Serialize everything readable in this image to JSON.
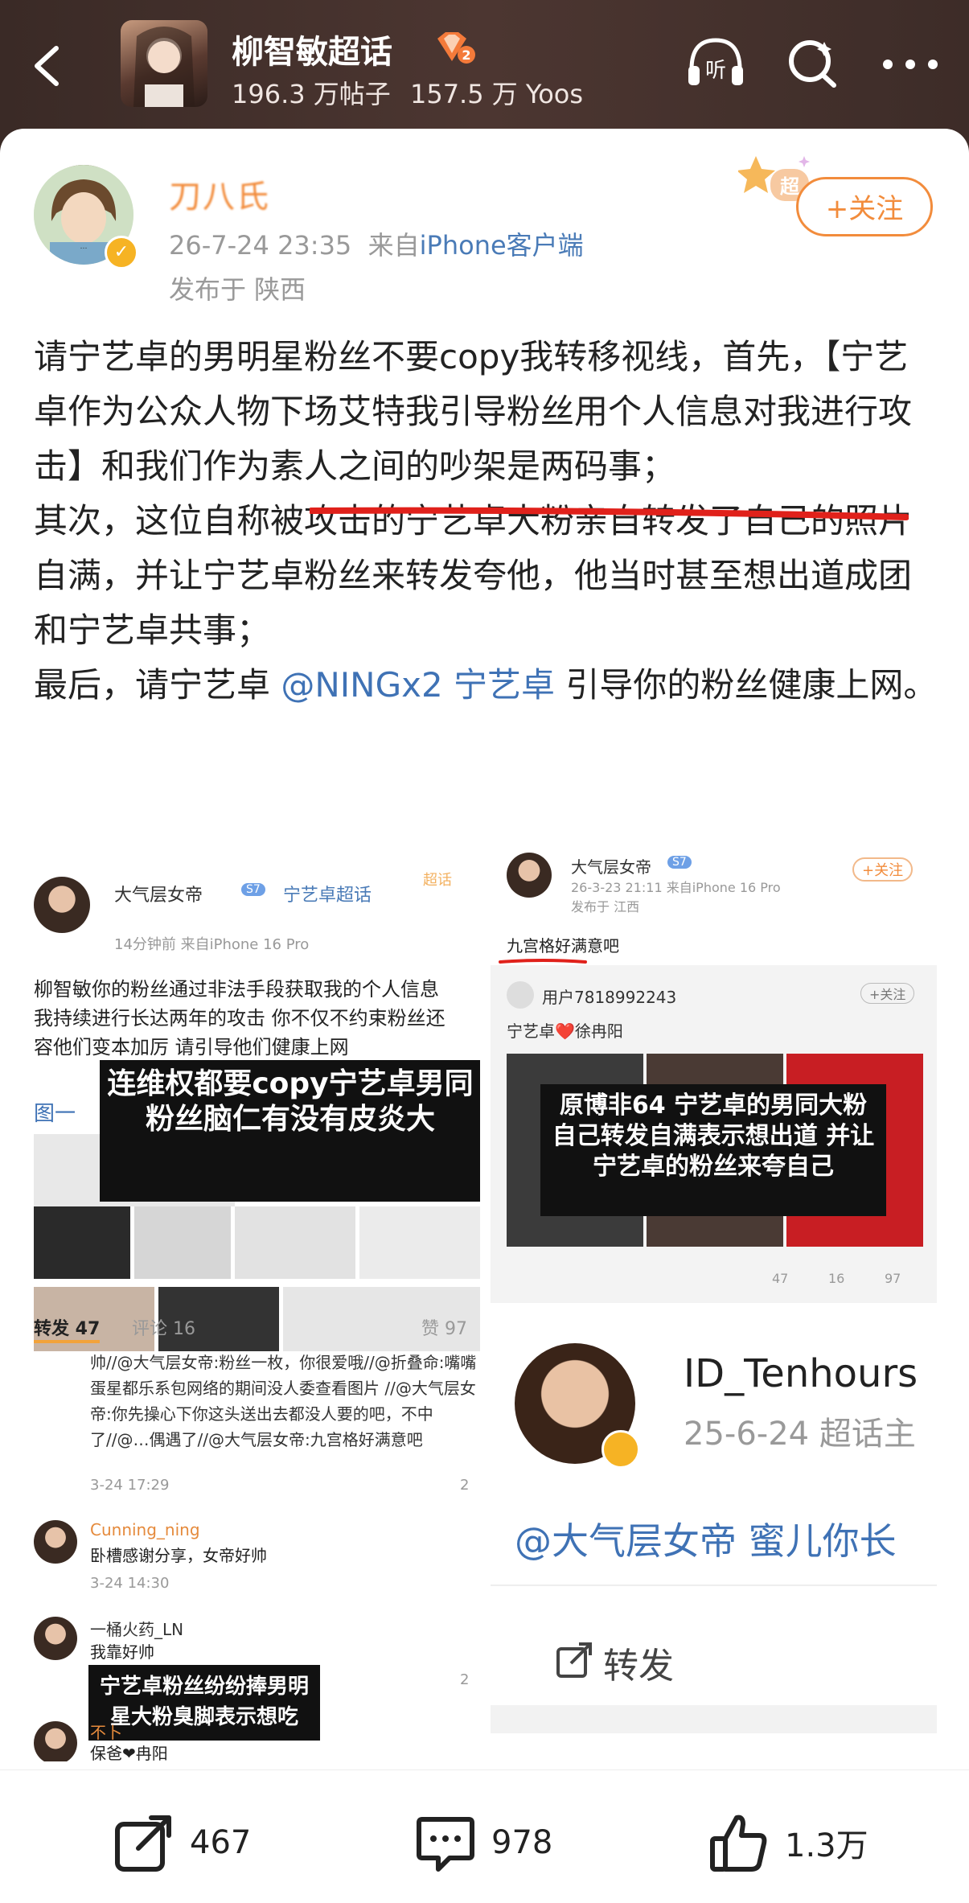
{
  "header": {
    "title": "柳智敏超话",
    "level_badge": "2",
    "posts": "196.3 万帖子",
    "yoos": "157.5 万 Yoos",
    "listen_label": "听"
  },
  "post": {
    "author": "刀八氏",
    "time": "26-7-24 23:35",
    "from_prefix": "来自",
    "source": "iPhone客户端",
    "location": "发布于 陕西",
    "follow_label": "+关注",
    "super_label": "超",
    "paragraphs": [
      "请宁艺卓的男明星粉丝不要copy我转移视线，首先，【宁艺卓作为公众人物下场艾特我引导粉丝用个人信息对我进行攻击】和我们作为素人之间的吵架是两码事；",
      "其次，这位自称被攻击的宁艺卓大粉亲自转发了自己的照片自满，并让宁艺卓粉丝来转发夸他，他当时甚至想出道成团和宁艺卓共事；"
    ],
    "last_prefix": "最后，请宁艺卓 ",
    "last_mention": "@NINGx2 宁艺卓",
    "last_suffix": " 引导你的粉丝健康上网。"
  },
  "shot_a": {
    "user": "大气层女帝",
    "level": "S7",
    "tag": "宁艺卓超话",
    "time": "14分钟前  来自iPhone 16 Pro",
    "super_tag": "超话",
    "line1": "柳智敏你的粉丝通过非法手段获取我的个人信息",
    "line2": "我持续进行长达两年的攻击 你不仅不约束粉丝还",
    "line3": "容他们变本加厉 请引导他们健康上网",
    "caption1": "连维权都要copy宁艺卓男同粉丝脑仁有没有皮炎大",
    "side_label": "图一",
    "tab_repost": "转发 47",
    "tab_comment": "评论 16",
    "likes": "赞 97",
    "thread": "帅//@大气层女帝:粉丝一枚，你很爱哦//@折叠命:嘴嘴蛋星都乐系包网络的期间没人委查看图片 //@大气层女帝:你先操心下你这头送出去都没人要的吧，不中了//@…偶遇了//@大气层女帝:九宫格好满意吧",
    "thread_time": "3-24 17:29",
    "c1_user": "Cunning_ning",
    "c1_text": "卧槽感谢分享，女帝好帅",
    "c1_time": "3-24 14:30",
    "c2_user": "一桶火药_LN",
    "c2_text": "我靠好帅",
    "c2_time": "3-24",
    "caption2": "宁艺卓粉丝纷纷捧男明星大粉臭脚表示想吃",
    "c3_user": "不卜",
    "c3_text": "保爸❤冉阳",
    "count2": "2"
  },
  "shot_b": {
    "user": "大气层女帝",
    "level": "S7",
    "time": "26-3-23 21:11 来自iPhone 16 Pro",
    "loc": "发布于 江西",
    "follow": "+关注",
    "text": "九宫格好满意吧",
    "repost_user": "用户7818992243",
    "repost_follow": "+关注",
    "repost_text": "宁艺卓❤️徐冉阳",
    "caption": "原博非64 宁艺卓的男同大粉自己转发自满表示想出道 并让宁艺卓的粉丝来夸自己",
    "stat1": "47",
    "stat2": "16",
    "stat3": "97"
  },
  "shot_c": {
    "user": "ID_Tenhours",
    "time": "25-6-24  超话主",
    "text": "@大气层女帝  蜜儿你长",
    "repost": "转发"
  },
  "actions": {
    "repost_count": "467",
    "comment_count": "978",
    "like_count": "1.3万"
  },
  "colors": {
    "header_bg": "#4c3631",
    "accent_orange": "#f28c3c",
    "link_blue": "#3f72b5",
    "underline_red": "#e0211b"
  }
}
